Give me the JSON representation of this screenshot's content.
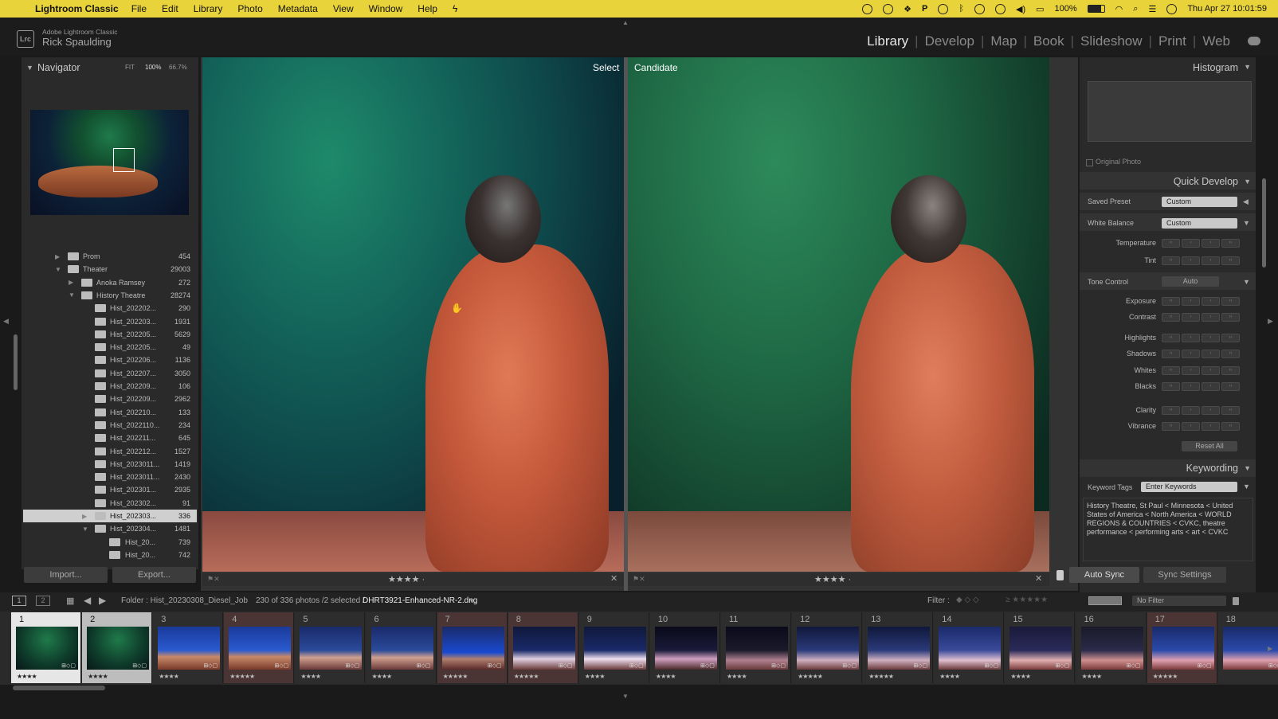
{
  "menubar": {
    "app_name": "Lightroom Classic",
    "items": [
      "File",
      "Edit",
      "Library",
      "Photo",
      "Metadata",
      "View",
      "Window",
      "Help"
    ],
    "battery": "100%",
    "datetime": "Thu Apr 27  10:01:59"
  },
  "header": {
    "logo": "Lrc",
    "product": "Adobe Lightroom Classic",
    "user": "Rick Spaulding",
    "modules": [
      "Library",
      "Develop",
      "Map",
      "Book",
      "Slideshow",
      "Print",
      "Web"
    ],
    "active_module": "Library"
  },
  "navigator": {
    "title": "Navigator",
    "zoom_options": [
      "FIT",
      "100%",
      "66.7%"
    ]
  },
  "folders": [
    {
      "label": "Prom",
      "count": "454",
      "level": 1,
      "arrow": "▶"
    },
    {
      "label": "Theater",
      "count": "29003",
      "level": 1,
      "arrow": "▼"
    },
    {
      "label": "Anoka Ramsey",
      "count": "272",
      "level": 2,
      "arrow": "▶"
    },
    {
      "label": "History Theatre",
      "count": "28274",
      "level": 2,
      "arrow": "▼"
    },
    {
      "label": "Hist_202202...",
      "count": "290",
      "level": 3,
      "arrow": ""
    },
    {
      "label": "Hist_202203...",
      "count": "1931",
      "level": 3,
      "arrow": ""
    },
    {
      "label": "Hist_202205...",
      "count": "5629",
      "level": 3,
      "arrow": ""
    },
    {
      "label": "Hist_202205...",
      "count": "49",
      "level": 3,
      "arrow": ""
    },
    {
      "label": "Hist_202206...",
      "count": "1136",
      "level": 3,
      "arrow": ""
    },
    {
      "label": "Hist_202207...",
      "count": "3050",
      "level": 3,
      "arrow": ""
    },
    {
      "label": "Hist_202209...",
      "count": "106",
      "level": 3,
      "arrow": ""
    },
    {
      "label": "Hist_202209...",
      "count": "2962",
      "level": 3,
      "arrow": ""
    },
    {
      "label": "Hist_202210...",
      "count": "133",
      "level": 3,
      "arrow": ""
    },
    {
      "label": "Hist_2022110...",
      "count": "234",
      "level": 3,
      "arrow": ""
    },
    {
      "label": "Hist_202211...",
      "count": "645",
      "level": 3,
      "arrow": ""
    },
    {
      "label": "Hist_202212...",
      "count": "1527",
      "level": 3,
      "arrow": ""
    },
    {
      "label": "Hist_2023011...",
      "count": "1419",
      "level": 3,
      "arrow": ""
    },
    {
      "label": "Hist_2023011...",
      "count": "2430",
      "level": 3,
      "arrow": ""
    },
    {
      "label": "Hist_202301...",
      "count": "2935",
      "level": 3,
      "arrow": ""
    },
    {
      "label": "Hist_202302...",
      "count": "91",
      "level": 3,
      "arrow": ""
    },
    {
      "label": "Hist_202303...",
      "count": "336",
      "level": 3,
      "arrow": "▶",
      "selected": true
    },
    {
      "label": "Hist_202304...",
      "count": "1481",
      "level": 3,
      "arrow": "▼"
    },
    {
      "label": "Hist_20...",
      "count": "739",
      "level": 4,
      "arrow": ""
    },
    {
      "label": "Hist_20...",
      "count": "742",
      "level": 4,
      "arrow": ""
    }
  ],
  "left_buttons": {
    "import": "Import...",
    "export": "Export..."
  },
  "compare": {
    "select_label": "Select",
    "candidate_label": "Candidate",
    "select_stars": "★★★★ ·",
    "candidate_stars": "★★★★ ·"
  },
  "histogram": {
    "title": "Histogram",
    "original_photo": "Original Photo"
  },
  "quick_develop": {
    "title": "Quick Develop",
    "saved_preset_label": "Saved Preset",
    "saved_preset_value": "Custom",
    "white_balance_label": "White Balance",
    "white_balance_value": "Custom",
    "temperature": "Temperature",
    "tint": "Tint",
    "tone_control_label": "Tone Control",
    "auto": "Auto",
    "exposure": "Exposure",
    "contrast": "Contrast",
    "highlights": "Highlights",
    "shadows": "Shadows",
    "whites": "Whites",
    "blacks": "Blacks",
    "clarity": "Clarity",
    "vibrance": "Vibrance",
    "reset_all": "Reset All"
  },
  "keywording": {
    "title": "Keywording",
    "tags_label": "Keyword Tags",
    "tags_value": "Enter Keywords",
    "keywords": "History Theatre, St Paul < Minnesota < United States of America < North America < WORLD REGIONS & COUNTRIES < CVKC, theatre performance < performing arts < art < CVKC"
  },
  "sync": {
    "auto_sync": "Auto Sync",
    "sync_settings": "Sync Settings"
  },
  "filmbar": {
    "view1": "1",
    "view2": "2",
    "folder": "Folder : Hist_20230308_Diesel_Job",
    "count": "230 of 336 photos /2 selected /",
    "filename": "DHRT3921-Enhanced-NR-2.dng",
    "filter_label": "Filter :",
    "filter_value": "No Filter"
  },
  "filmstrip": [
    {
      "num": "1",
      "stars": "★★★★",
      "selected": true
    },
    {
      "num": "2",
      "stars": "★★★★",
      "selected": true
    },
    {
      "num": "3",
      "stars": "★★★★"
    },
    {
      "num": "4",
      "stars": "★★★★★",
      "pink": true
    },
    {
      "num": "5",
      "stars": "★★★★"
    },
    {
      "num": "6",
      "stars": "★★★★"
    },
    {
      "num": "7",
      "stars": "★★★★★",
      "pink": true
    },
    {
      "num": "8",
      "stars": "★★★★★",
      "pink": true
    },
    {
      "num": "9",
      "stars": "★★★★"
    },
    {
      "num": "10",
      "stars": "★★★★"
    },
    {
      "num": "11",
      "stars": "★★★★"
    },
    {
      "num": "12",
      "stars": "★★★★★"
    },
    {
      "num": "13",
      "stars": "★★★★★"
    },
    {
      "num": "14",
      "stars": "★★★★"
    },
    {
      "num": "15",
      "stars": "★★★★"
    },
    {
      "num": "16",
      "stars": "★★★★"
    },
    {
      "num": "17",
      "stars": "★★★★★",
      "pink": true
    },
    {
      "num": "18",
      "stars": ""
    }
  ]
}
